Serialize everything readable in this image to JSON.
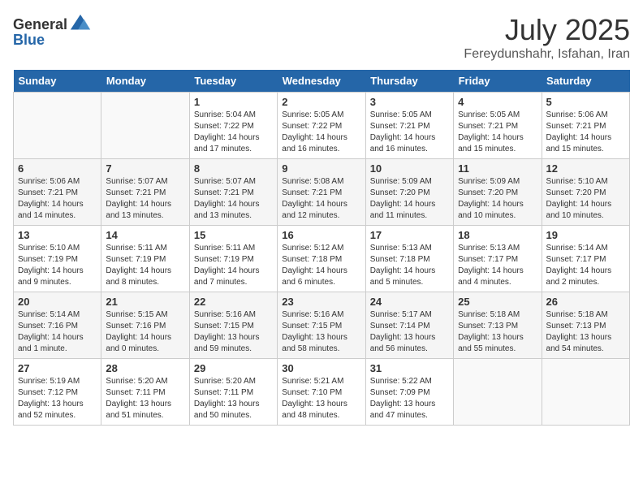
{
  "header": {
    "logo_general": "General",
    "logo_blue": "Blue",
    "title": "July 2025",
    "location": "Fereydunshahr, Isfahan, Iran"
  },
  "weekdays": [
    "Sunday",
    "Monday",
    "Tuesday",
    "Wednesday",
    "Thursday",
    "Friday",
    "Saturday"
  ],
  "weeks": [
    [
      {
        "day": "",
        "info": ""
      },
      {
        "day": "",
        "info": ""
      },
      {
        "day": "1",
        "info": "Sunrise: 5:04 AM\nSunset: 7:22 PM\nDaylight: 14 hours and 17 minutes."
      },
      {
        "day": "2",
        "info": "Sunrise: 5:05 AM\nSunset: 7:22 PM\nDaylight: 14 hours and 16 minutes."
      },
      {
        "day": "3",
        "info": "Sunrise: 5:05 AM\nSunset: 7:21 PM\nDaylight: 14 hours and 16 minutes."
      },
      {
        "day": "4",
        "info": "Sunrise: 5:05 AM\nSunset: 7:21 PM\nDaylight: 14 hours and 15 minutes."
      },
      {
        "day": "5",
        "info": "Sunrise: 5:06 AM\nSunset: 7:21 PM\nDaylight: 14 hours and 15 minutes."
      }
    ],
    [
      {
        "day": "6",
        "info": "Sunrise: 5:06 AM\nSunset: 7:21 PM\nDaylight: 14 hours and 14 minutes."
      },
      {
        "day": "7",
        "info": "Sunrise: 5:07 AM\nSunset: 7:21 PM\nDaylight: 14 hours and 13 minutes."
      },
      {
        "day": "8",
        "info": "Sunrise: 5:07 AM\nSunset: 7:21 PM\nDaylight: 14 hours and 13 minutes."
      },
      {
        "day": "9",
        "info": "Sunrise: 5:08 AM\nSunset: 7:21 PM\nDaylight: 14 hours and 12 minutes."
      },
      {
        "day": "10",
        "info": "Sunrise: 5:09 AM\nSunset: 7:20 PM\nDaylight: 14 hours and 11 minutes."
      },
      {
        "day": "11",
        "info": "Sunrise: 5:09 AM\nSunset: 7:20 PM\nDaylight: 14 hours and 10 minutes."
      },
      {
        "day": "12",
        "info": "Sunrise: 5:10 AM\nSunset: 7:20 PM\nDaylight: 14 hours and 10 minutes."
      }
    ],
    [
      {
        "day": "13",
        "info": "Sunrise: 5:10 AM\nSunset: 7:19 PM\nDaylight: 14 hours and 9 minutes."
      },
      {
        "day": "14",
        "info": "Sunrise: 5:11 AM\nSunset: 7:19 PM\nDaylight: 14 hours and 8 minutes."
      },
      {
        "day": "15",
        "info": "Sunrise: 5:11 AM\nSunset: 7:19 PM\nDaylight: 14 hours and 7 minutes."
      },
      {
        "day": "16",
        "info": "Sunrise: 5:12 AM\nSunset: 7:18 PM\nDaylight: 14 hours and 6 minutes."
      },
      {
        "day": "17",
        "info": "Sunrise: 5:13 AM\nSunset: 7:18 PM\nDaylight: 14 hours and 5 minutes."
      },
      {
        "day": "18",
        "info": "Sunrise: 5:13 AM\nSunset: 7:17 PM\nDaylight: 14 hours and 4 minutes."
      },
      {
        "day": "19",
        "info": "Sunrise: 5:14 AM\nSunset: 7:17 PM\nDaylight: 14 hours and 2 minutes."
      }
    ],
    [
      {
        "day": "20",
        "info": "Sunrise: 5:14 AM\nSunset: 7:16 PM\nDaylight: 14 hours and 1 minute."
      },
      {
        "day": "21",
        "info": "Sunrise: 5:15 AM\nSunset: 7:16 PM\nDaylight: 14 hours and 0 minutes."
      },
      {
        "day": "22",
        "info": "Sunrise: 5:16 AM\nSunset: 7:15 PM\nDaylight: 13 hours and 59 minutes."
      },
      {
        "day": "23",
        "info": "Sunrise: 5:16 AM\nSunset: 7:15 PM\nDaylight: 13 hours and 58 minutes."
      },
      {
        "day": "24",
        "info": "Sunrise: 5:17 AM\nSunset: 7:14 PM\nDaylight: 13 hours and 56 minutes."
      },
      {
        "day": "25",
        "info": "Sunrise: 5:18 AM\nSunset: 7:13 PM\nDaylight: 13 hours and 55 minutes."
      },
      {
        "day": "26",
        "info": "Sunrise: 5:18 AM\nSunset: 7:13 PM\nDaylight: 13 hours and 54 minutes."
      }
    ],
    [
      {
        "day": "27",
        "info": "Sunrise: 5:19 AM\nSunset: 7:12 PM\nDaylight: 13 hours and 52 minutes."
      },
      {
        "day": "28",
        "info": "Sunrise: 5:20 AM\nSunset: 7:11 PM\nDaylight: 13 hours and 51 minutes."
      },
      {
        "day": "29",
        "info": "Sunrise: 5:20 AM\nSunset: 7:11 PM\nDaylight: 13 hours and 50 minutes."
      },
      {
        "day": "30",
        "info": "Sunrise: 5:21 AM\nSunset: 7:10 PM\nDaylight: 13 hours and 48 minutes."
      },
      {
        "day": "31",
        "info": "Sunrise: 5:22 AM\nSunset: 7:09 PM\nDaylight: 13 hours and 47 minutes."
      },
      {
        "day": "",
        "info": ""
      },
      {
        "day": "",
        "info": ""
      }
    ]
  ]
}
